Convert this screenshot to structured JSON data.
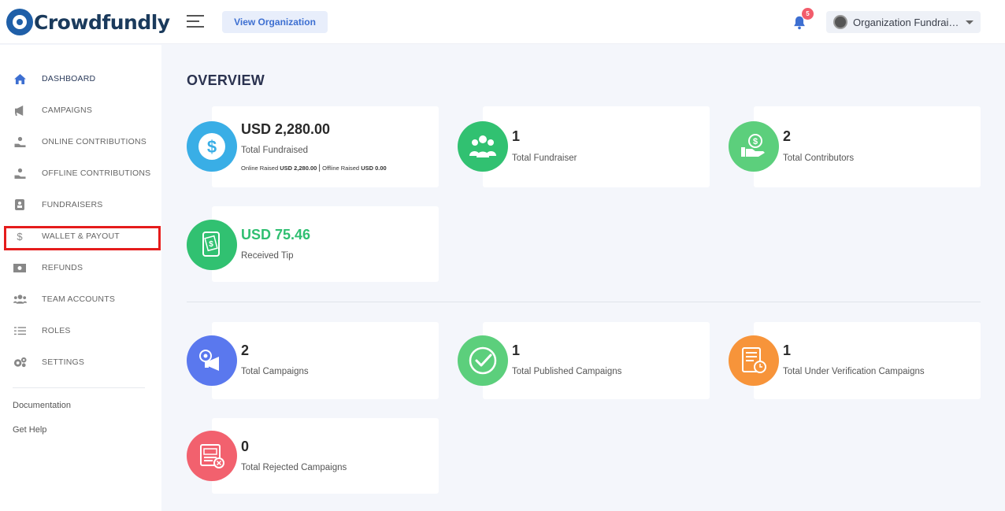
{
  "app": {
    "name": "Crowdfundly"
  },
  "header": {
    "view_org_label": "View Organization",
    "notification_count": "5",
    "org_name": "Organization Fundraising"
  },
  "sidebar": {
    "items": [
      {
        "label": "DASHBOARD",
        "icon": "home-icon",
        "active": true
      },
      {
        "label": "CAMPAIGNS",
        "icon": "megaphone-icon"
      },
      {
        "label": "ONLINE CONTRIBUTIONS",
        "icon": "hand-coin-icon"
      },
      {
        "label": "OFFLINE CONTRIBUTIONS",
        "icon": "hand-coin-icon"
      },
      {
        "label": "FUNDRAISERS",
        "icon": "contact-card-icon"
      },
      {
        "label": "WALLET & PAYOUT",
        "icon": "dollar-icon",
        "highlighted": true
      },
      {
        "label": "REFUNDS",
        "icon": "money-bill-icon"
      },
      {
        "label": "TEAM ACCOUNTS",
        "icon": "users-icon"
      },
      {
        "label": "ROLES",
        "icon": "list-check-icon"
      },
      {
        "label": "SETTINGS",
        "icon": "cogs-icon"
      }
    ],
    "links": [
      {
        "label": "Documentation"
      },
      {
        "label": "Get Help"
      }
    ]
  },
  "main": {
    "title": "OVERVIEW",
    "stats": {
      "total_fundraised": {
        "value": "USD 2,280.00",
        "label": "Total Fundraised",
        "online_prefix": "Online Raised",
        "online_value": "USD 2,280.00",
        "offline_prefix": "Offline Raised",
        "offline_value": "USD 0.00"
      },
      "total_fundraiser": {
        "value": "1",
        "label": "Total Fundraiser"
      },
      "total_contributors": {
        "value": "2",
        "label": "Total Contributors"
      },
      "received_tip": {
        "value": "USD 75.46",
        "label": "Received Tip"
      },
      "total_campaigns": {
        "value": "2",
        "label": "Total Campaigns"
      },
      "total_published": {
        "value": "1",
        "label": "Total Published Campaigns"
      },
      "total_under_verification": {
        "value": "1",
        "label": "Total Under Verification Campaigns"
      },
      "total_rejected": {
        "value": "0",
        "label": "Total Rejected Campaigns"
      }
    }
  },
  "colors": {
    "blue_circle": "#39aee6",
    "green_circle": "#31c171",
    "light_green_circle": "#5ccf7c",
    "indigo_circle": "#5a78ee",
    "orange_circle": "#f7943a",
    "red_circle": "#f2616e",
    "tip_value": "#2fbf71",
    "highlight_border": "#e51c1c"
  }
}
